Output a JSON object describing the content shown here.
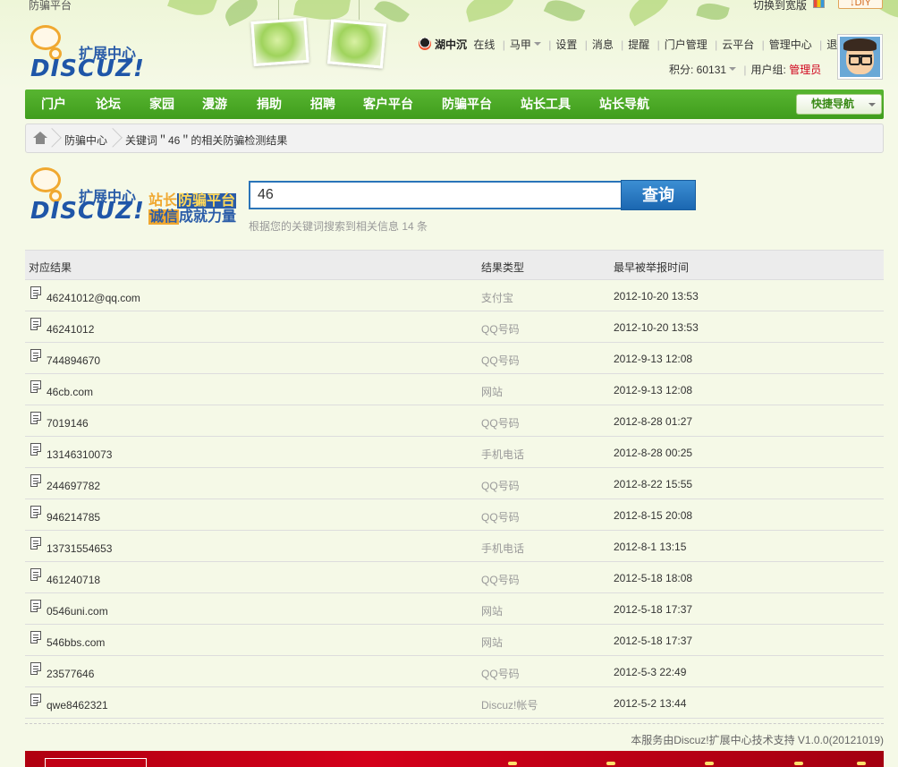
{
  "top_bar": {
    "left_link": "防骗平台",
    "switch_width": "切换到宽版",
    "diy_button": "DIY"
  },
  "logo": {
    "title_cn": "扩展中心",
    "title_en": "DISCUZ!"
  },
  "user": {
    "name": "湖中沉",
    "status": "在线",
    "menu": [
      "马甲",
      "设置",
      "消息",
      "提醒",
      "门户管理",
      "云平台",
      "管理中心",
      "退出"
    ],
    "points_label": "积分: 60131",
    "group_label": "用户组:",
    "group_value": "管理员"
  },
  "nav": {
    "items": [
      "门户",
      "论坛",
      "家园",
      "漫游",
      "捐助",
      "招聘",
      "客户平台",
      "防骗平台",
      "站长工具",
      "站长导航"
    ],
    "quick_nav": "快捷导航"
  },
  "breadcrumb": {
    "items": [
      "防骗中心",
      "关键词＂46＂的相关防骗检测结果"
    ]
  },
  "search": {
    "logo_cn": "扩展中心",
    "logo_en": "DISCUZ!",
    "tagline_1a": "站长",
    "tagline_1b": "防骗平台",
    "tagline_2a": "诚信",
    "tagline_2b": "成就力量",
    "query": "46",
    "button": "查询",
    "summary": "根据您的关键词搜索到相关信息 14 条"
  },
  "table": {
    "headers": [
      "对应结果",
      "结果类型",
      "最早被举报时间"
    ],
    "rows": [
      {
        "value": "46241012@qq.com",
        "type": "支付宝",
        "time": "2012-10-20 13:53"
      },
      {
        "value": "46241012",
        "type": "QQ号码",
        "time": "2012-10-20 13:53"
      },
      {
        "value": "744894670",
        "type": "QQ号码",
        "time": "2012-9-13 12:08"
      },
      {
        "value": "46cb.com",
        "type": "网站",
        "time": "2012-9-13 12:08"
      },
      {
        "value": "7019146",
        "type": "QQ号码",
        "time": "2012-8-28 01:27"
      },
      {
        "value": "13146310073",
        "type": "手机电话",
        "time": "2012-8-28 00:25"
      },
      {
        "value": "244697782",
        "type": "QQ号码",
        "time": "2012-8-22 15:55"
      },
      {
        "value": "946214785",
        "type": "QQ号码",
        "time": "2012-8-15 20:08"
      },
      {
        "value": "13731554653",
        "type": "手机电话",
        "time": "2012-8-1 13:15"
      },
      {
        "value": "461240718",
        "type": "QQ号码",
        "time": "2012-5-18 18:08"
      },
      {
        "value": "0546uni.com",
        "type": "网站",
        "time": "2012-5-18 17:37"
      },
      {
        "value": "546bbs.com",
        "type": "网站",
        "time": "2012-5-18 17:37"
      },
      {
        "value": "23577646",
        "type": "QQ号码",
        "time": "2012-5-3 22:49"
      },
      {
        "value": "qwe8462321",
        "type": "Discuz!帐号",
        "time": "2012-5-2 13:44"
      }
    ]
  },
  "footer": {
    "support": "本服务由Discuz!扩展中心技术支持 V1.0.0(20121019)"
  },
  "colors": {
    "nav_green": "#4aa826",
    "brand_blue": "#2a5ca8",
    "brand_orange": "#f0a830",
    "admin_red": "#d0021b"
  }
}
